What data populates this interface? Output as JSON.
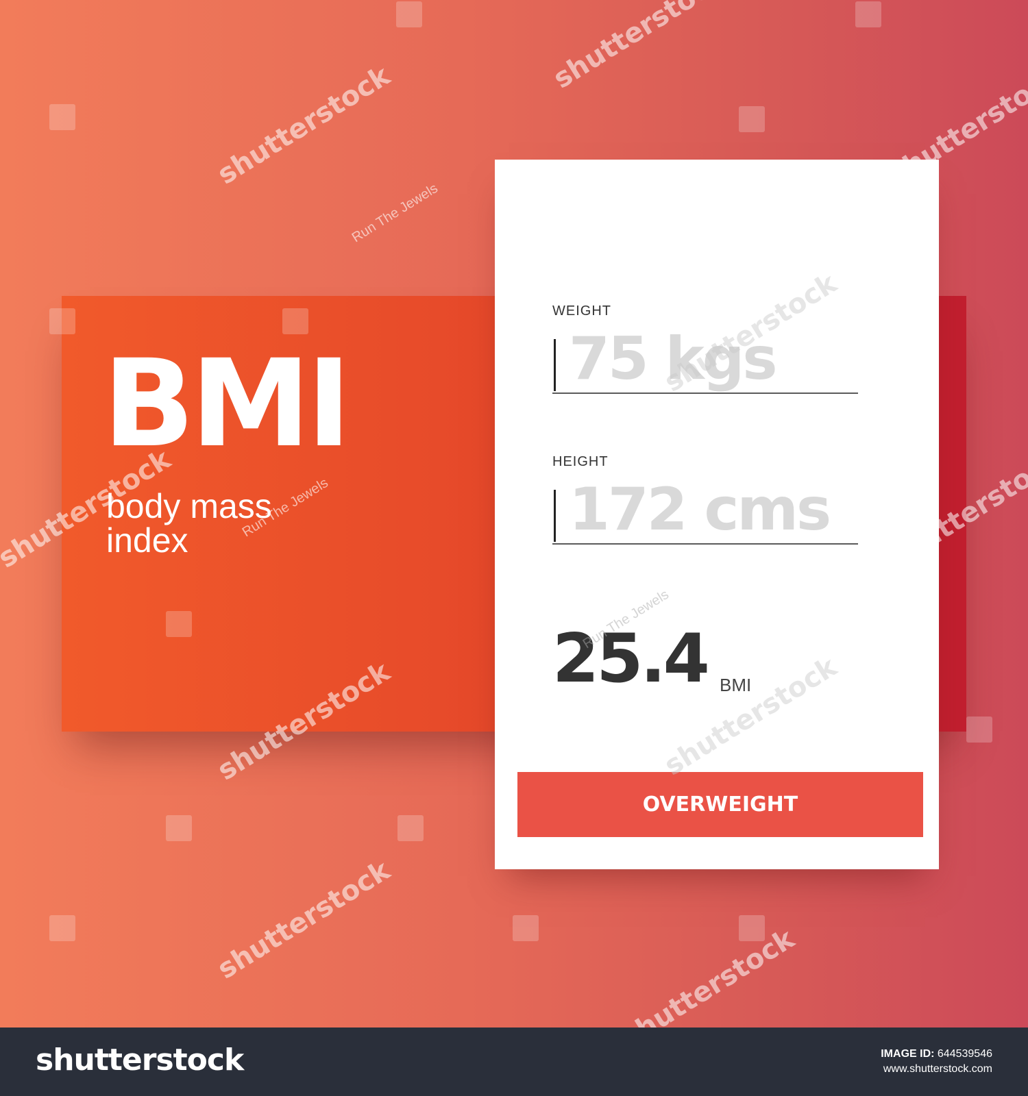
{
  "hero": {
    "title": "BMI",
    "subtitle_line1": "body mass",
    "subtitle_line2": "index"
  },
  "form": {
    "weight_label": "WEIGHT",
    "weight_placeholder": "75 kgs",
    "height_label": "HEIGHT",
    "height_placeholder": "172 cms"
  },
  "result": {
    "value": "25.4",
    "unit": "BMI",
    "status": "OVERWEIGHT"
  },
  "watermark": {
    "brand": "shutterstock",
    "artist": "Run The Jewels"
  },
  "footer": {
    "logo": "shutterstock",
    "image_id_label": "IMAGE ID:",
    "image_id": "644539546",
    "url": "www.shutterstock.com"
  },
  "colors": {
    "accent": "#ea5246",
    "hero_orange": "#f15a2b",
    "background_start": "#f27c5a",
    "background_end": "#cc4a58"
  }
}
